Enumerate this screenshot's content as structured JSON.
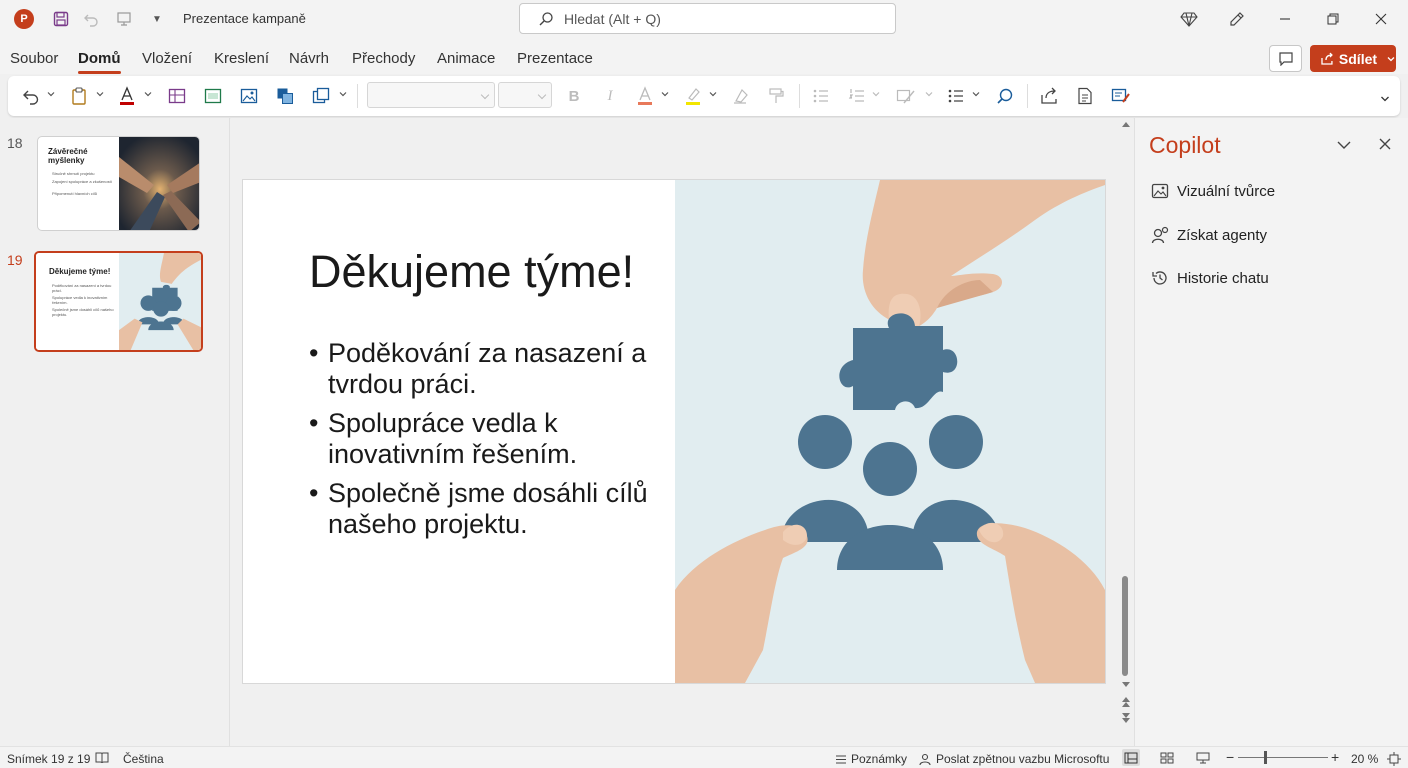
{
  "titlebar": {
    "doc_title": "Prezentace kampaně",
    "search_placeholder": "Hledat (Alt + Q)"
  },
  "menu": {
    "tabs": [
      "Soubor",
      "Domů",
      "Vložení",
      "Kreslení",
      "Návrh",
      "Přechody",
      "Animace",
      "Prezentace"
    ],
    "active_tab": "Domů",
    "share_label": "Sdílet"
  },
  "thumbnails": [
    {
      "number": "18",
      "title": "Závěrečné myšlenky",
      "bullets": [
        "Stručně shrnutí projektu",
        "Zapojení spolupráce a zkušeností",
        "Připomenutí hlavních cílů"
      ]
    },
    {
      "number": "19",
      "title": "Děkujeme týme!",
      "bullets": [
        "Poděkování za nasazení a tvrdou práci.",
        "Spolupráce vedla k inovativním řešením.",
        "Společně jsme dosáhli cílů našeho projektu."
      ]
    }
  ],
  "slide": {
    "title": "Děkujeme týme!",
    "bullets": [
      "Poděkování za nasazení a tvrdou práci.",
      "Spolupráce vedla k inovativním řešením.",
      "Společně jsme dosáhli cílů našeho projektu."
    ]
  },
  "copilot": {
    "title": "Copilot",
    "items": [
      "Vizuální tvůrce",
      "Získat agenty",
      "Historie chatu"
    ]
  },
  "statusbar": {
    "slide_info": "Snímek 19 z 19",
    "language": "Čeština",
    "notes": "Poznámky",
    "feedback": "Poslat zpětnou vazbu Microsoftu",
    "zoom": "20 %"
  },
  "colors": {
    "accent": "#c43e1c",
    "puzzle": "#4d7490",
    "image_bg": "#e1edf0"
  }
}
